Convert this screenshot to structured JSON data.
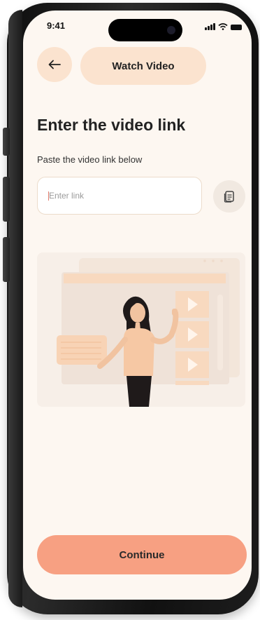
{
  "status_bar": {
    "time": "9:41"
  },
  "header": {
    "back_icon": "arrow-left-icon",
    "title": "Watch Video"
  },
  "content": {
    "heading": "Enter the video link",
    "subheading": "Paste the video link below",
    "link_input": {
      "value": "",
      "placeholder": "Enter link"
    },
    "paste_icon": "clipboard-icon"
  },
  "footer": {
    "continue_label": "Continue"
  },
  "colors": {
    "background": "#fdf7f1",
    "accent_light": "#fbe3cf",
    "accent": "#f7a082",
    "text": "#222222"
  }
}
